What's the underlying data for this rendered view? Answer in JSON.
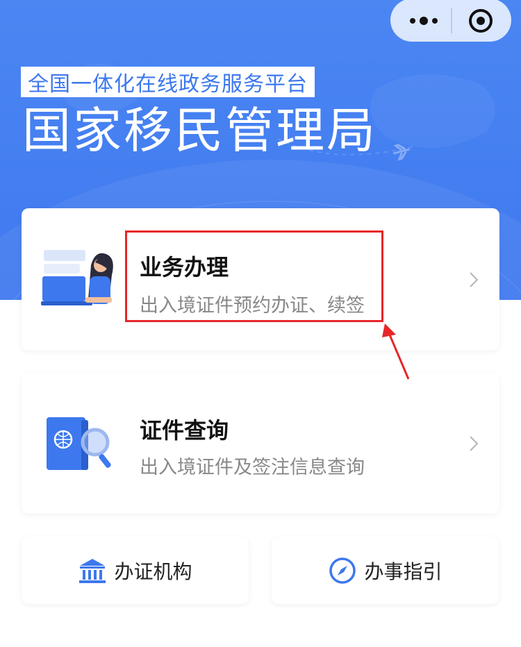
{
  "header": {
    "subtitle": "全国一体化在线政务服务平台",
    "title": "国家移民管理局"
  },
  "capsule": {
    "more_icon": "more-dots-icon",
    "close_icon": "target-close-icon"
  },
  "cards": [
    {
      "title": "业务办理",
      "desc": "出入境证件预约办证、续签",
      "icon": "person-laptop-illustration"
    },
    {
      "title": "证件查询",
      "desc": "出入境证件及签注信息查询",
      "icon": "passport-search-illustration"
    }
  ],
  "buttons": [
    {
      "label": "办证机构",
      "icon": "bank-building-icon"
    },
    {
      "label": "办事指引",
      "icon": "compass-icon"
    }
  ],
  "colors": {
    "primary_blue": "#4b86f3",
    "annotation_red": "#e6262a"
  }
}
